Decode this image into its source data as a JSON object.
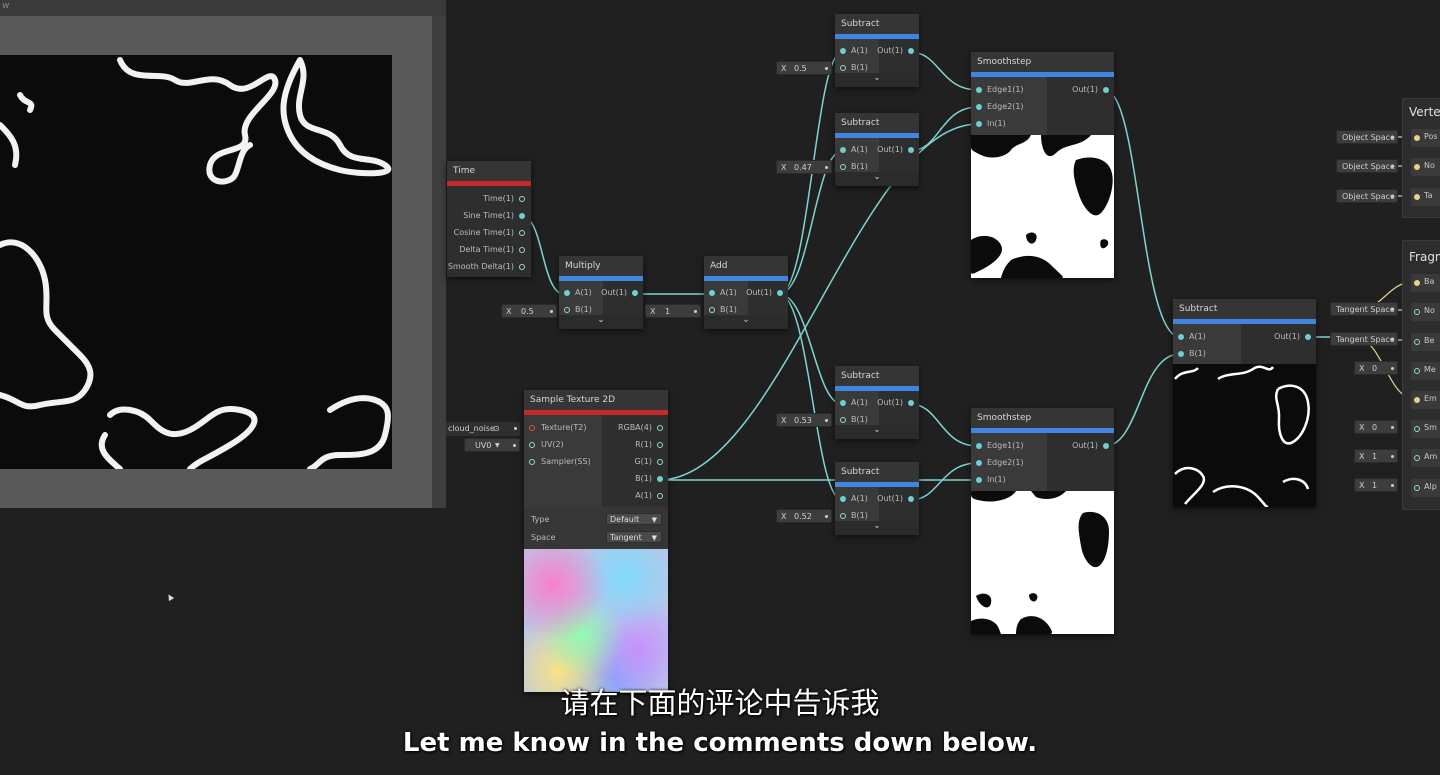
{
  "preview": {
    "title": "w"
  },
  "time_node": {
    "title": "Time",
    "outputs": [
      "Time(1)",
      "Sine Time(1)",
      "Cosine Time(1)",
      "Delta Time(1)",
      "Smooth Delta(1)"
    ]
  },
  "multiply_node": {
    "title": "Multiply",
    "in_a": "A(1)",
    "in_b": "B(1)",
    "out": "Out(1)",
    "b_value": "0.5"
  },
  "add_node": {
    "title": "Add",
    "in_a": "A(1)",
    "in_b": "B(1)",
    "out": "Out(1)",
    "b_value": "1"
  },
  "subtract_nodes": [
    {
      "title": "Subtract",
      "in_a": "A(1)",
      "in_b": "B(1)",
      "out": "Out(1)",
      "b_value": "0.5"
    },
    {
      "title": "Subtract",
      "in_a": "A(1)",
      "in_b": "B(1)",
      "out": "Out(1)",
      "b_value": "0.47"
    },
    {
      "title": "Subtract",
      "in_a": "A(1)",
      "in_b": "B(1)",
      "out": "Out(1)",
      "b_value": "0.53"
    },
    {
      "title": "Subtract",
      "in_a": "A(1)",
      "in_b": "B(1)",
      "out": "Out(1)",
      "b_value": "0.52"
    }
  ],
  "smoothstep_nodes": [
    {
      "title": "Smoothstep",
      "edge1": "Edge1(1)",
      "edge2": "Edge2(1)",
      "in": "In(1)",
      "out": "Out(1)"
    },
    {
      "title": "Smoothstep",
      "edge1": "Edge1(1)",
      "edge2": "Edge2(1)",
      "in": "In(1)",
      "out": "Out(1)"
    }
  ],
  "final_subtract": {
    "title": "Subtract",
    "in_a": "A(1)",
    "in_b": "B(1)",
    "out": "Out(1)"
  },
  "sample_texture": {
    "title": "Sample Texture 2D",
    "inputs": [
      "Texture(T2)",
      "UV(2)",
      "Sampler(SS)"
    ],
    "outputs": [
      "RGBA(4)",
      "R(1)",
      "G(1)",
      "B(1)",
      "A(1)"
    ],
    "texture_value": "cloud_noise",
    "uv_value": "UV0",
    "type_label": "Type",
    "type_value": "Default",
    "space_label": "Space",
    "space_value": "Tangent"
  },
  "field_prefix": "X",
  "vertex_stack": {
    "title": "Verte",
    "rows": [
      {
        "space": "Object Space",
        "label": "Pos"
      },
      {
        "space": "Object Space",
        "label": "No"
      },
      {
        "space": "Object Space",
        "label": "Ta"
      }
    ]
  },
  "fragment_stack": {
    "title": "Fragm",
    "rows": [
      {
        "value": "",
        "label": "Ba"
      },
      {
        "value": "Tangent Space",
        "label": "No"
      },
      {
        "value": "Tangent Space",
        "label": "Be"
      },
      {
        "value": "0",
        "label": "Me"
      },
      {
        "value": "",
        "label": "Em"
      },
      {
        "value": "0",
        "label": "Sm"
      },
      {
        "value": "1",
        "label": "Am"
      },
      {
        "value": "1",
        "label": "Alp"
      }
    ]
  },
  "subtitles": {
    "cn": "请在下面的评论中告诉我",
    "en": "Let me know in the comments down below."
  },
  "colors": {
    "wire": "#7fd4d4",
    "accent_blue": "#3f86e0",
    "accent_red": "#c42a2a",
    "background": "#202020"
  }
}
